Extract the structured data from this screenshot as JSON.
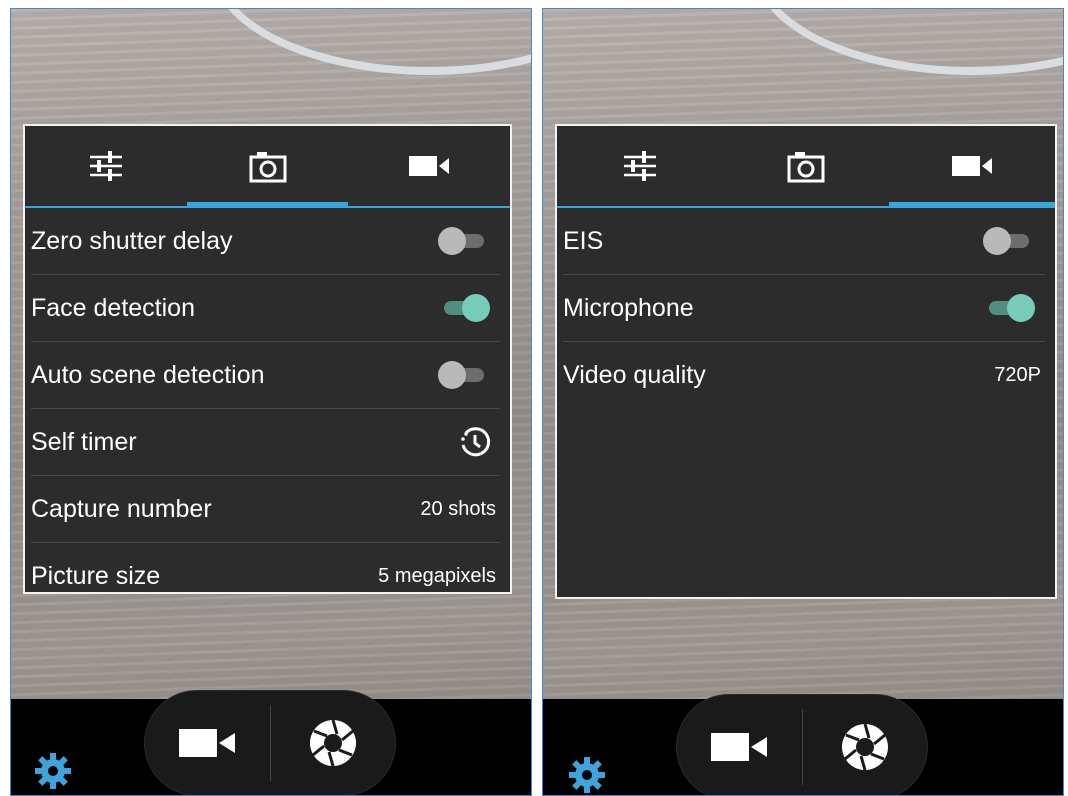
{
  "colors": {
    "accent": "#35a7dc",
    "panel_bg": "#2d2c2c",
    "toggle_on": "#77cbb9",
    "settings_gear": "#3fa3dc"
  },
  "left": {
    "tabs": [
      {
        "icon": "sliders-icon",
        "active": false
      },
      {
        "icon": "camera-icon",
        "active": true
      },
      {
        "icon": "video-camera-icon",
        "active": false
      }
    ],
    "settings": [
      {
        "label": "Zero shutter delay",
        "control": "toggle",
        "state": "off"
      },
      {
        "label": "Face detection",
        "control": "toggle",
        "state": "on"
      },
      {
        "label": "Auto scene detection",
        "control": "toggle",
        "state": "off"
      },
      {
        "label": "Self timer",
        "control": "icon",
        "icon": "timer-icon"
      },
      {
        "label": "Capture number",
        "control": "value",
        "value": "20 shots"
      },
      {
        "label": "Picture size",
        "control": "value",
        "value": "5 megapixels"
      }
    ],
    "bottom": {
      "left_icon": "video-camera-icon",
      "right_icon": "shutter-icon",
      "settings_icon": "gear-icon"
    }
  },
  "right": {
    "tabs": [
      {
        "icon": "sliders-icon",
        "active": false
      },
      {
        "icon": "camera-icon",
        "active": false
      },
      {
        "icon": "video-camera-icon",
        "active": true
      }
    ],
    "settings": [
      {
        "label": "EIS",
        "control": "toggle",
        "state": "off"
      },
      {
        "label": "Microphone",
        "control": "toggle",
        "state": "on"
      },
      {
        "label": "Video quality",
        "control": "value",
        "value": "720P"
      }
    ],
    "bottom": {
      "left_icon": "video-camera-icon",
      "right_icon": "shutter-icon",
      "settings_icon": "gear-icon"
    }
  }
}
